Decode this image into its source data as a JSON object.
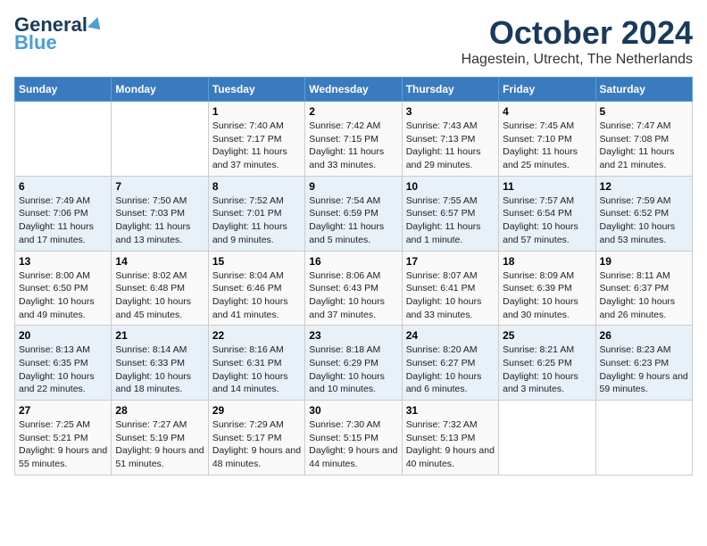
{
  "header": {
    "logo_line1": "General",
    "logo_line2": "Blue",
    "month": "October 2024",
    "location": "Hagestein, Utrecht, The Netherlands"
  },
  "days_of_week": [
    "Sunday",
    "Monday",
    "Tuesday",
    "Wednesday",
    "Thursday",
    "Friday",
    "Saturday"
  ],
  "weeks": [
    [
      {
        "day": "",
        "content": ""
      },
      {
        "day": "",
        "content": ""
      },
      {
        "day": "1",
        "content": "Sunrise: 7:40 AM\nSunset: 7:17 PM\nDaylight: 11 hours and 37 minutes."
      },
      {
        "day": "2",
        "content": "Sunrise: 7:42 AM\nSunset: 7:15 PM\nDaylight: 11 hours and 33 minutes."
      },
      {
        "day": "3",
        "content": "Sunrise: 7:43 AM\nSunset: 7:13 PM\nDaylight: 11 hours and 29 minutes."
      },
      {
        "day": "4",
        "content": "Sunrise: 7:45 AM\nSunset: 7:10 PM\nDaylight: 11 hours and 25 minutes."
      },
      {
        "day": "5",
        "content": "Sunrise: 7:47 AM\nSunset: 7:08 PM\nDaylight: 11 hours and 21 minutes."
      }
    ],
    [
      {
        "day": "6",
        "content": "Sunrise: 7:49 AM\nSunset: 7:06 PM\nDaylight: 11 hours and 17 minutes."
      },
      {
        "day": "7",
        "content": "Sunrise: 7:50 AM\nSunset: 7:03 PM\nDaylight: 11 hours and 13 minutes."
      },
      {
        "day": "8",
        "content": "Sunrise: 7:52 AM\nSunset: 7:01 PM\nDaylight: 11 hours and 9 minutes."
      },
      {
        "day": "9",
        "content": "Sunrise: 7:54 AM\nSunset: 6:59 PM\nDaylight: 11 hours and 5 minutes."
      },
      {
        "day": "10",
        "content": "Sunrise: 7:55 AM\nSunset: 6:57 PM\nDaylight: 11 hours and 1 minute."
      },
      {
        "day": "11",
        "content": "Sunrise: 7:57 AM\nSunset: 6:54 PM\nDaylight: 10 hours and 57 minutes."
      },
      {
        "day": "12",
        "content": "Sunrise: 7:59 AM\nSunset: 6:52 PM\nDaylight: 10 hours and 53 minutes."
      }
    ],
    [
      {
        "day": "13",
        "content": "Sunrise: 8:00 AM\nSunset: 6:50 PM\nDaylight: 10 hours and 49 minutes."
      },
      {
        "day": "14",
        "content": "Sunrise: 8:02 AM\nSunset: 6:48 PM\nDaylight: 10 hours and 45 minutes."
      },
      {
        "day": "15",
        "content": "Sunrise: 8:04 AM\nSunset: 6:46 PM\nDaylight: 10 hours and 41 minutes."
      },
      {
        "day": "16",
        "content": "Sunrise: 8:06 AM\nSunset: 6:43 PM\nDaylight: 10 hours and 37 minutes."
      },
      {
        "day": "17",
        "content": "Sunrise: 8:07 AM\nSunset: 6:41 PM\nDaylight: 10 hours and 33 minutes."
      },
      {
        "day": "18",
        "content": "Sunrise: 8:09 AM\nSunset: 6:39 PM\nDaylight: 10 hours and 30 minutes."
      },
      {
        "day": "19",
        "content": "Sunrise: 8:11 AM\nSunset: 6:37 PM\nDaylight: 10 hours and 26 minutes."
      }
    ],
    [
      {
        "day": "20",
        "content": "Sunrise: 8:13 AM\nSunset: 6:35 PM\nDaylight: 10 hours and 22 minutes."
      },
      {
        "day": "21",
        "content": "Sunrise: 8:14 AM\nSunset: 6:33 PM\nDaylight: 10 hours and 18 minutes."
      },
      {
        "day": "22",
        "content": "Sunrise: 8:16 AM\nSunset: 6:31 PM\nDaylight: 10 hours and 14 minutes."
      },
      {
        "day": "23",
        "content": "Sunrise: 8:18 AM\nSunset: 6:29 PM\nDaylight: 10 hours and 10 minutes."
      },
      {
        "day": "24",
        "content": "Sunrise: 8:20 AM\nSunset: 6:27 PM\nDaylight: 10 hours and 6 minutes."
      },
      {
        "day": "25",
        "content": "Sunrise: 8:21 AM\nSunset: 6:25 PM\nDaylight: 10 hours and 3 minutes."
      },
      {
        "day": "26",
        "content": "Sunrise: 8:23 AM\nSunset: 6:23 PM\nDaylight: 9 hours and 59 minutes."
      }
    ],
    [
      {
        "day": "27",
        "content": "Sunrise: 7:25 AM\nSunset: 5:21 PM\nDaylight: 9 hours and 55 minutes."
      },
      {
        "day": "28",
        "content": "Sunrise: 7:27 AM\nSunset: 5:19 PM\nDaylight: 9 hours and 51 minutes."
      },
      {
        "day": "29",
        "content": "Sunrise: 7:29 AM\nSunset: 5:17 PM\nDaylight: 9 hours and 48 minutes."
      },
      {
        "day": "30",
        "content": "Sunrise: 7:30 AM\nSunset: 5:15 PM\nDaylight: 9 hours and 44 minutes."
      },
      {
        "day": "31",
        "content": "Sunrise: 7:32 AM\nSunset: 5:13 PM\nDaylight: 9 hours and 40 minutes."
      },
      {
        "day": "",
        "content": ""
      },
      {
        "day": "",
        "content": ""
      }
    ]
  ]
}
